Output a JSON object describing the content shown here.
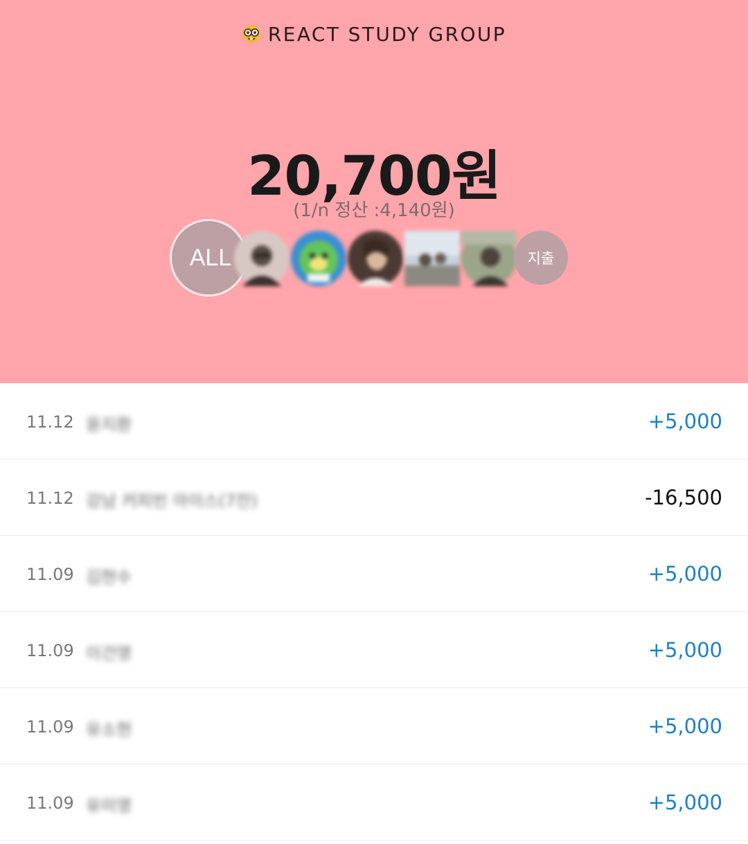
{
  "header": {
    "group_icon": "nerd-face-emoji-icon",
    "group_name": "REACT STUDY GROUP",
    "total": "20,700원",
    "per_person": "(1/n 정산 :4,140원)",
    "background_color": "#ffa5ab"
  },
  "avatars": {
    "all_label": "ALL",
    "spend_label": "지출",
    "members": [
      {
        "icon": "member-avatar-1",
        "color": "#6c5b57"
      },
      {
        "icon": "member-avatar-2",
        "color": "#58b95a"
      },
      {
        "icon": "member-avatar-3",
        "color": "#7d5c4f"
      },
      {
        "icon": "member-avatar-4",
        "color": "#a7b2bd"
      },
      {
        "icon": "member-avatar-5",
        "color": "#6f6a63"
      }
    ]
  },
  "transactions": [
    {
      "date": "11.12",
      "name": "윤지환",
      "amount": "+5,000",
      "kind": "income"
    },
    {
      "date": "11.12",
      "name": "강남 커피빈 아이스(7잔)",
      "amount": "-16,500",
      "kind": "expense"
    },
    {
      "date": "11.09",
      "name": "김현수",
      "amount": "+5,000",
      "kind": "income"
    },
    {
      "date": "11.09",
      "name": "이건영",
      "amount": "+5,000",
      "kind": "income"
    },
    {
      "date": "11.09",
      "name": "유소현",
      "amount": "+5,000",
      "kind": "income"
    },
    {
      "date": "11.09",
      "name": "유미영",
      "amount": "+5,000",
      "kind": "income"
    }
  ],
  "colors": {
    "income": "#1e7fc7",
    "expense": "#111111",
    "avatar_overlay": "#bda0a4"
  }
}
